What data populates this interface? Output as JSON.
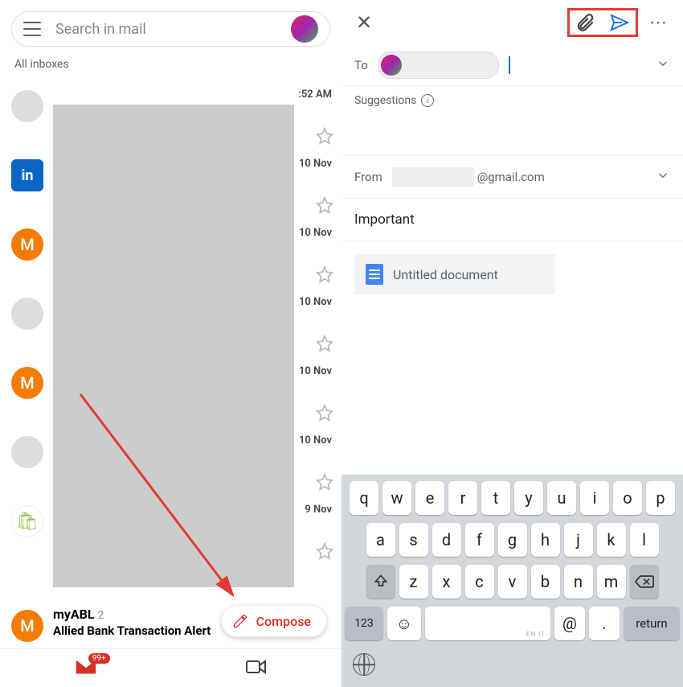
{
  "left": {
    "search_placeholder": "Search in mail",
    "all_inboxes": "All inboxes",
    "compose": "Compose",
    "badge": "99+",
    "myabl": {
      "title": "myABL",
      "count": "2",
      "subject": "Allied Bank Transaction Alert"
    },
    "rows": [
      {
        "avatar_type": "gray",
        "initial": "",
        "time": ":52 AM"
      },
      {
        "avatar_type": "linkedin",
        "initial": "in",
        "time": "10 Nov"
      },
      {
        "avatar_type": "orange",
        "initial": "M",
        "time": "10 Nov"
      },
      {
        "avatar_type": "gray",
        "initial": "",
        "time": "10 Nov"
      },
      {
        "avatar_type": "orange",
        "initial": "M",
        "time": "10 Nov"
      },
      {
        "avatar_type": "gray",
        "initial": "",
        "time": "10 Nov"
      },
      {
        "avatar_type": "shopify",
        "initial": "🛍",
        "time": "9 Nov"
      }
    ]
  },
  "right": {
    "to_label": "To",
    "suggestions": "Suggestions",
    "from_label": "From",
    "from_domain": "@gmail.com",
    "subject": "Important",
    "attachment": "Untitled document",
    "keyboard": {
      "row1": [
        "q",
        "w",
        "e",
        "r",
        "t",
        "y",
        "u",
        "i",
        "o",
        "p"
      ],
      "row2": [
        "a",
        "s",
        "d",
        "f",
        "g",
        "h",
        "j",
        "k",
        "l"
      ],
      "row3": [
        "z",
        "x",
        "c",
        "v",
        "b",
        "n",
        "m"
      ],
      "num": "123",
      "at": "@",
      "dot": ".",
      "return": "return",
      "space_hint": "EN IT"
    }
  }
}
